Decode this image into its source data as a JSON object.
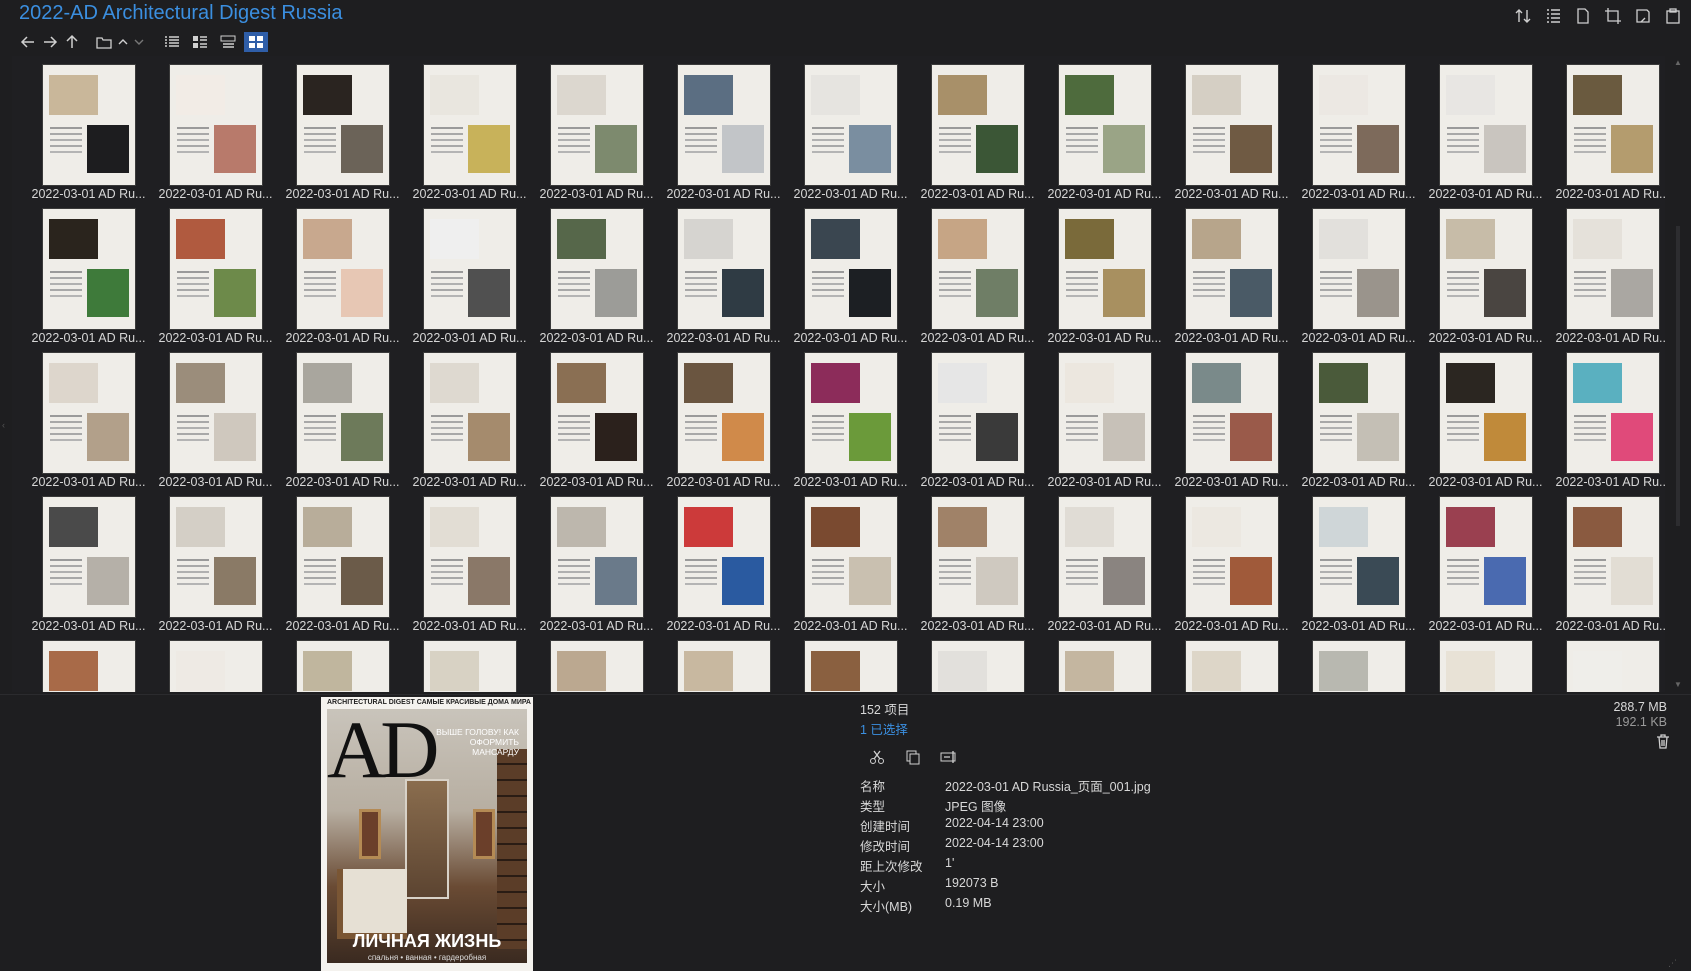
{
  "window": {
    "title": "2022-AD Architectural Digest Russia",
    "top_icons": [
      "sort-icon",
      "details-icon",
      "new-file-icon",
      "crop-icon",
      "tag-icon",
      "clipboard-icon"
    ]
  },
  "nav": {
    "buttons": [
      "back-icon",
      "forward-icon",
      "up-icon",
      "folder-icon",
      "caret-up-icon",
      "caret-down-icon"
    ],
    "views": [
      "list-view-icon",
      "detail-view-icon",
      "tiles-view-icon",
      "thumbnail-view-icon"
    ],
    "active_view": "thumbnail-view-icon"
  },
  "grid": {
    "item_label": "2022-03-01 AD Ru...",
    "columns": 13,
    "rows_visible": 5,
    "colors": [
      [
        "#c9b79a",
        "#1d1d1f"
      ],
      [
        "#f2ece6",
        "#b87a6b"
      ],
      [
        "#2a2420",
        "#6b6358"
      ],
      [
        "#e9e6df",
        "#c8b25a"
      ],
      [
        "#dcd7cf",
        "#7d8a6e"
      ],
      [
        "#5b6e82",
        "#c2c5c8"
      ],
      [
        "#e6e4e0",
        "#7a8ea0"
      ],
      [
        "#a89069",
        "#3b5636"
      ],
      [
        "#4e6b3d",
        "#9aa486"
      ],
      [
        "#d5cfc4",
        "#6f5a43"
      ],
      [
        "#ece8e3",
        "#7d6a5b"
      ],
      [
        "#e8e6e3",
        "#c9c5bf"
      ],
      [
        "#6a5a3f",
        "#b49c6e"
      ],
      [
        "#2a241d",
        "#3e7a3a"
      ],
      [
        "#b05a3f",
        "#6d8a4a"
      ],
      [
        "#c8a88e",
        "#e7c7b4"
      ],
      [
        "#efefef",
        "#505050"
      ],
      [
        "#56674a",
        "#9c9c98"
      ],
      [
        "#d6d4d0",
        "#2f3b44"
      ],
      [
        "#3a4650",
        "#1c1f23"
      ],
      [
        "#c6a585",
        "#6f7e66"
      ],
      [
        "#7a6a3a",
        "#a89060"
      ],
      [
        "#b7a58b",
        "#4a5a66"
      ],
      [
        "#e2e0dc",
        "#9a948c"
      ],
      [
        "#c7bca8",
        "#4a4541"
      ],
      [
        "#e5e1da",
        "#aaa7a2"
      ],
      [
        "#ddd6cc",
        "#b2a08a"
      ],
      [
        "#9b8d7b",
        "#cfc8be"
      ],
      [
        "#a9a69e",
        "#6d7a5a"
      ],
      [
        "#ded9d0",
        "#a58b6d"
      ],
      [
        "#8a6f53",
        "#2b211c"
      ],
      [
        "#6a5540",
        "#d08a4a"
      ],
      [
        "#8c2c5a",
        "#6b9a3a"
      ],
      [
        "#e6e6e6",
        "#3a3a3a"
      ],
      [
        "#ece7df",
        "#c7c1b8"
      ],
      [
        "#7a8a8a",
        "#9a5a4a"
      ],
      [
        "#4a5a3a",
        "#c4bfb5"
      ],
      [
        "#2b2621",
        "#c08a3a"
      ],
      [
        "#5ab0c0",
        "#e04a7a"
      ],
      [
        "#4a4a4a",
        "#b5b0a8"
      ],
      [
        "#d4cfc6",
        "#8a7a66"
      ],
      [
        "#b8ad9a",
        "#6b5b49"
      ],
      [
        "#e2ddd4",
        "#8a7868"
      ],
      [
        "#bdb7ad",
        "#6a7a8a"
      ],
      [
        "#cc3a3a",
        "#2a5aa0"
      ],
      [
        "#7a4a30",
        "#c9c0b0"
      ],
      [
        "#a08268",
        "#cfc9c0"
      ],
      [
        "#e0dcd5",
        "#8a8480"
      ],
      [
        "#ece8e1",
        "#a05a3a"
      ],
      [
        "#cfd6d8",
        "#3a4a55"
      ],
      [
        "#9a4050",
        "#4a6ab0"
      ],
      [
        "#8a5a40",
        "#e2ddd4"
      ],
      [
        "#a86a48",
        "#dcd0c0"
      ],
      [
        "#eeeae4",
        "#3a3a3a"
      ],
      [
        "#c0b69e",
        "#8a7a5a"
      ],
      [
        "#d8d2c4",
        "#6a6050"
      ],
      [
        "#bba890",
        "#3a3a3a"
      ],
      [
        "#c8b8a0",
        "#7a6040"
      ],
      [
        "#8a6040",
        "#c0a080"
      ],
      [
        "#e2e0dc",
        "#b0aca6"
      ],
      [
        "#c4b6a0",
        "#7a6a56"
      ],
      [
        "#ddd6c8",
        "#9a8a6a"
      ],
      [
        "#b8b8b0",
        "#5a6a60"
      ],
      [
        "#e8e2d6",
        "#c0b8a8"
      ],
      [
        "#efeeea",
        "#9c9690"
      ]
    ]
  },
  "preview": {
    "masthead": "ARCHITECTURAL DIGEST САМЫЕ КРАСИВЫЕ ДОМА МИРА",
    "logo": "AD",
    "headline": "ВЫШЕ ГОЛОВУ! КАК ОФОРМИТЬ МАНСАРДУ",
    "cover_title": "ЛИЧНАЯ ЖИЗНЬ",
    "cover_sub": "спальня • ванная • гардеробная"
  },
  "info": {
    "count": "152 项目",
    "selected": "1 已选择",
    "actions": [
      "cut-icon",
      "copy-icon",
      "rename-icon"
    ],
    "props": [
      {
        "k": "名称",
        "v": "2022-03-01 AD Russia_页面_001.jpg"
      },
      {
        "k": "类型",
        "v": "JPEG 图像"
      },
      {
        "k": "创建时间",
        "v": "2022-04-14  23:00"
      },
      {
        "k": "修改时间",
        "v": "2022-04-14  23:00"
      },
      {
        "k": "距上次修改",
        "v": "1'"
      },
      {
        "k": "大小",
        "v": "192073 B"
      },
      {
        "k": "大小(MB)",
        "v": "0.19 MB"
      }
    ],
    "total_size": "288.7 MB",
    "selected_size": "192.1 KB"
  }
}
